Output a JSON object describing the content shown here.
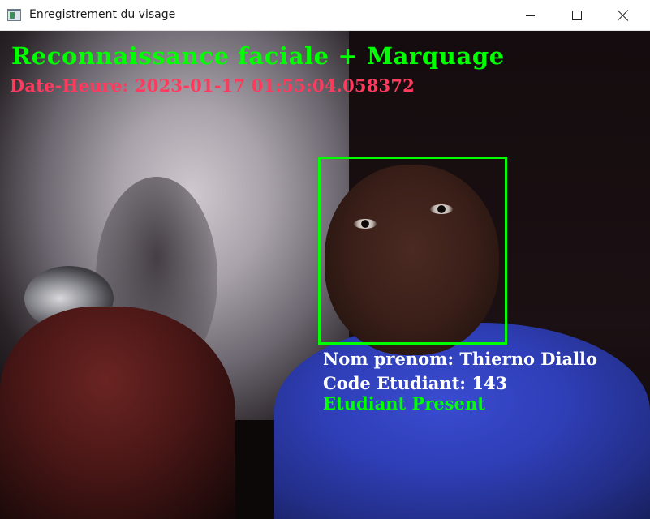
{
  "window": {
    "title": "Enregistrement du visage",
    "controls": {
      "minimize": "minimize-icon",
      "maximize": "maximize-icon",
      "close": "close-icon"
    }
  },
  "overlay": {
    "title": "Reconnaissance faciale + Marquage",
    "datetime": "Date-Heure: 2023-01-17 01:55:04.058372",
    "name": "Nom prenom: Thierno Diallo",
    "student_code": "Code Etudiant: 143",
    "status": "Etudiant Present"
  },
  "colors": {
    "title": "#00ff00",
    "datetime": "#ff3a5c",
    "face_box": "#00ff00",
    "info_text": "#ffffff",
    "status": "#00ff00"
  }
}
